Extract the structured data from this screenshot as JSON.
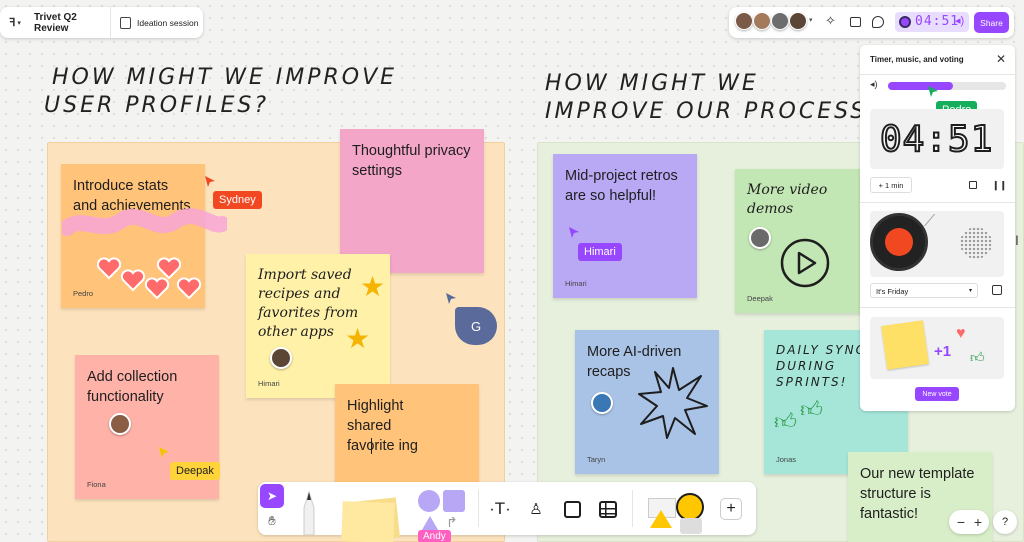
{
  "header": {
    "file_name": "Trivet Q2 Review",
    "page_name": "Ideation session",
    "timer_display": "04:51",
    "share_label": "Share"
  },
  "sections": {
    "left_heading_line1": "HOW MIGHT WE IMPROVE",
    "left_heading_line2": "USER PROFILES?",
    "right_heading_line1": "HOW MIGHT WE",
    "right_heading_line2": "IMPROVE OUR PROCESS?"
  },
  "stickies": {
    "stats": {
      "text": "Introduce stats and achievements",
      "author": "Pedro"
    },
    "privacy": {
      "text": "Thoughtful privacy settings"
    },
    "import": {
      "text": "Import saved recipes and favorites from other apps",
      "author": "Himari"
    },
    "collection": {
      "text": "Add collection functionality",
      "author": "Fiona"
    },
    "highlight": {
      "text": "Highlight shared favorite ing"
    },
    "retros": {
      "text": "Mid-project retros are so helpful!",
      "author": "Himari"
    },
    "video": {
      "text": "More video demos",
      "author": "Deepak"
    },
    "ai": {
      "text": "More AI-driven recaps",
      "author": "Taryn"
    },
    "daily": {
      "text": "DAILY SYNCS DURING SPRINTS!",
      "author": "Jonas"
    },
    "template": {
      "text": "Our new template structure is fantastic!"
    }
  },
  "cursors": {
    "sydney": "Sydney",
    "himari": "Himari",
    "deepak": "Deepak",
    "pedro": "Pedro",
    "andy": "Andy",
    "g_initial": "G"
  },
  "timer_panel": {
    "title": "Timer, music, and voting",
    "time_display": "04:51",
    "add_minute_label": "+ 1 min",
    "song_selected": "It's Friday",
    "new_vote_label": "New vote",
    "volume_fraction": 0.55
  },
  "colors": {
    "accent": "#9747ff",
    "left_section": "#fde3bd",
    "right_section": "#e6f0dc"
  }
}
